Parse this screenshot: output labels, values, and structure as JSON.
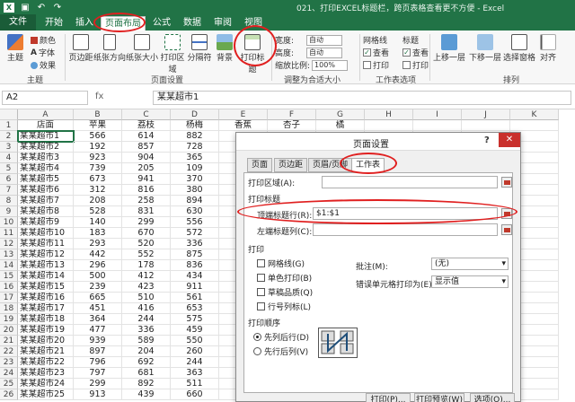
{
  "window": {
    "title": "021、打印EXCEL标题栏，跨页表格查看更不方便 - Excel"
  },
  "quick_access": {
    "save_icon": "save-icon",
    "undo_icon": "undo-icon",
    "redo_icon": "redo-icon"
  },
  "tabs": [
    "文件",
    "开始",
    "插入",
    "页面布局",
    "公式",
    "数据",
    "审阅",
    "视图"
  ],
  "ribbon": {
    "theme": {
      "label": "主题",
      "colors": "颜色",
      "fonts": "字体",
      "effects": "效果",
      "group": "主题"
    },
    "page_setup": {
      "margins": "页边距",
      "orientation": "纸张方向",
      "size": "纸张大小",
      "print_area": "打印区域",
      "breaks": "分隔符",
      "background": "背景",
      "print_titles": "打印标题",
      "group": "页面设置"
    },
    "scale": {
      "width": "宽度:",
      "height": "高度:",
      "scale": "缩放比例:",
      "width_val": "自动",
      "height_val": "自动",
      "scale_val": "100%",
      "group": "调整为合适大小"
    },
    "sheet_options": {
      "gridlines": "网格线",
      "headings": "标题",
      "view": "查看",
      "print": "打印",
      "group": "工作表选项"
    },
    "arrange": {
      "bring_forward": "上移一层",
      "send_backward": "下移一层",
      "selection_pane": "选择窗格",
      "align": "对齐",
      "group": "排列"
    }
  },
  "formula_bar": {
    "name_box": "A2",
    "fx": "fx",
    "content": "某某超市1"
  },
  "sheet": {
    "columns": [
      "A",
      "B",
      "C",
      "D",
      "E",
      "F",
      "G",
      "H",
      "I",
      "J",
      "K"
    ],
    "header_row": [
      "店面",
      "苹果",
      "荔枝",
      "杨梅",
      "香蕉",
      "杏子",
      "橘"
    ],
    "rows": [
      [
        "某某超市1",
        "566",
        "614",
        "882"
      ],
      [
        "某某超市2",
        "192",
        "857",
        "728"
      ],
      [
        "某某超市3",
        "923",
        "904",
        "365"
      ],
      [
        "某某超市4",
        "739",
        "205",
        "109"
      ],
      [
        "某某超市5",
        "673",
        "941",
        "370"
      ],
      [
        "某某超市6",
        "312",
        "816",
        "380"
      ],
      [
        "某某超市7",
        "208",
        "258",
        "894"
      ],
      [
        "某某超市8",
        "528",
        "831",
        "630"
      ],
      [
        "某某超市9",
        "140",
        "299",
        "556"
      ],
      [
        "某某超市10",
        "183",
        "670",
        "572"
      ],
      [
        "某某超市11",
        "293",
        "520",
        "336"
      ],
      [
        "某某超市12",
        "442",
        "552",
        "875"
      ],
      [
        "某某超市13",
        "296",
        "178",
        "836"
      ],
      [
        "某某超市14",
        "500",
        "412",
        "434"
      ],
      [
        "某某超市15",
        "239",
        "423",
        "911"
      ],
      [
        "某某超市16",
        "665",
        "510",
        "561"
      ],
      [
        "某某超市17",
        "451",
        "416",
        "653"
      ],
      [
        "某某超市18",
        "364",
        "244",
        "575"
      ],
      [
        "某某超市19",
        "477",
        "336",
        "459"
      ],
      [
        "某某超市20",
        "939",
        "589",
        "550"
      ],
      [
        "某某超市21",
        "897",
        "204",
        "260"
      ],
      [
        "某某超市22",
        "796",
        "692",
        "244"
      ],
      [
        "某某超市23",
        "797",
        "681",
        "363"
      ],
      [
        "某某超市24",
        "299",
        "892",
        "511"
      ],
      [
        "某某超市25",
        "913",
        "439",
        "660"
      ]
    ]
  },
  "dialog": {
    "title": "页面设置",
    "help": "?",
    "close": "✕",
    "tabs": [
      "页面",
      "页边距",
      "页眉/页脚",
      "工作表"
    ],
    "print_area": "打印区域(A):",
    "print_titles": "打印标题",
    "rows_repeat": "顶端标题行(R):",
    "rows_repeat_value": "$1:$1",
    "cols_repeat": "左端标题列(C):",
    "print_section": "打印",
    "gridlines": "网格线(G)",
    "black_white": "单色打印(B)",
    "draft": "草稿品质(Q)",
    "row_col_headings": "行号列标(L)",
    "comments": "批注(M):",
    "comments_value": "(无)",
    "errors": "错误单元格打印为(E):",
    "errors_value": "显示值",
    "page_order": "打印顺序",
    "down_then_over": "先列后行(D)",
    "over_then_down": "先行后列(V)",
    "print_btn": "打印(P)...",
    "preview_btn": "打印预览(W)",
    "options_btn": "选项(O)..."
  }
}
